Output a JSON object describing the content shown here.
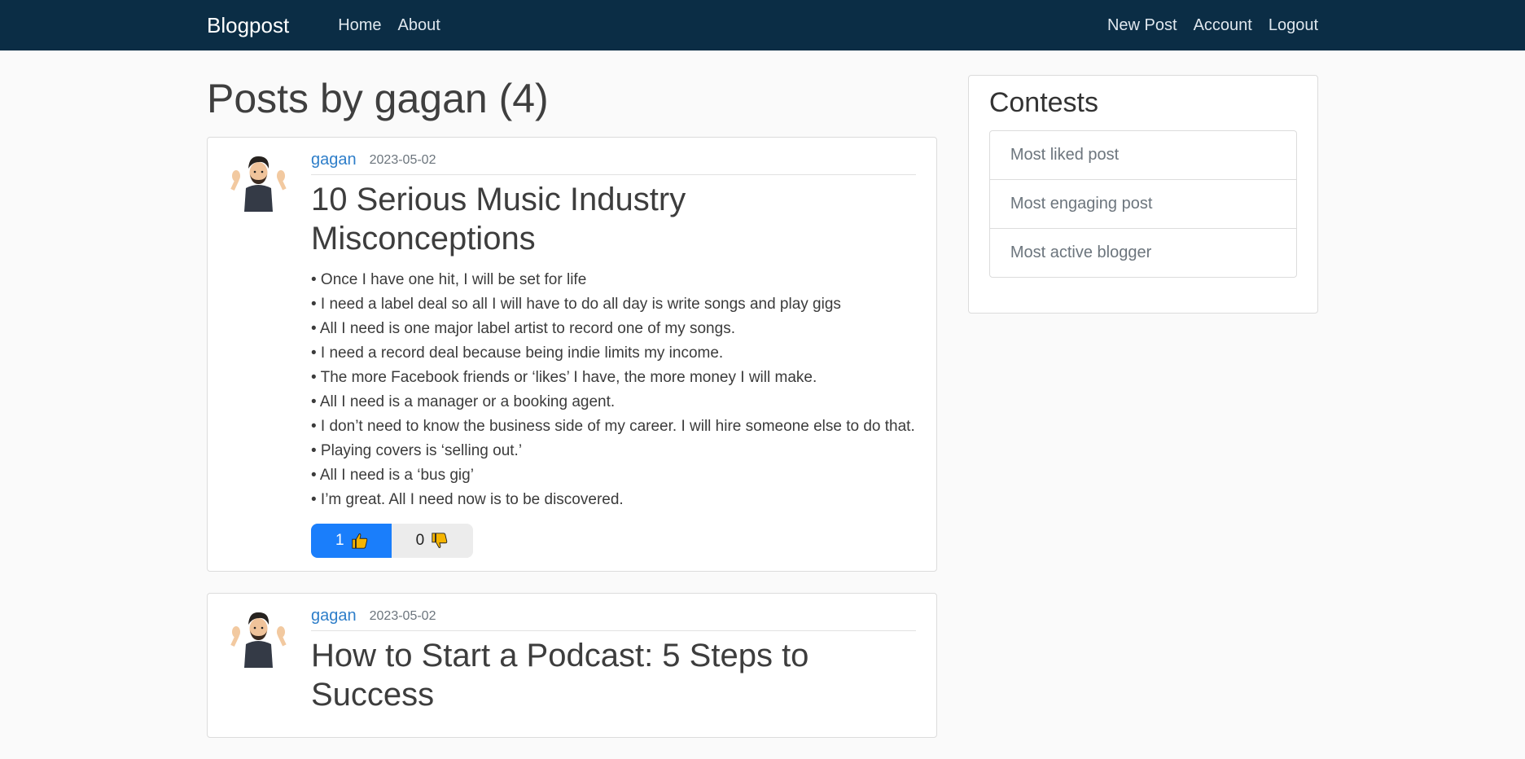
{
  "nav": {
    "brand": "Blogpost",
    "left_links": [
      "Home",
      "About"
    ],
    "right_links": [
      "New Post",
      "Account",
      "Logout"
    ]
  },
  "page": {
    "title": "Posts by gagan (4)"
  },
  "posts": [
    {
      "author": "gagan",
      "date": "2023-05-02",
      "title": "10 Serious Music Industry Misconceptions",
      "lines": [
        "• Once I have one hit, I will be set for life",
        "• I need a label deal so all I will have to do all day is write songs and play gigs",
        "• All I need is one major label artist to record one of my songs.",
        "• I need a record deal because being indie limits my income.",
        "• The more Facebook friends or ‘likes’ I have, the more money I will make.",
        "• All I need is a manager or a booking agent.",
        "• I don’t need to know the business side of my career. I will hire someone else to do that.",
        "• Playing covers is ‘selling out.’",
        "• All I need is a ‘bus gig’",
        "• I’m great. All I need now is to be discovered."
      ],
      "likes": "1",
      "dislikes": "0"
    },
    {
      "author": "gagan",
      "date": "2023-05-02",
      "title": "How to Start a Podcast: 5 Steps to Success"
    }
  ],
  "sidebar": {
    "title": "Contests",
    "items": [
      "Most liked post",
      "Most engaging post",
      "Most active blogger"
    ]
  },
  "icons": {
    "avatar": "memoji-avatar-icon",
    "like": "thumbs-up-icon",
    "dislike": "thumbs-down-icon"
  },
  "colors": {
    "navbar": "#0b2d45",
    "link": "#2e7ec9",
    "like_button": "#1a7efb",
    "dislike_button": "#ececec"
  }
}
